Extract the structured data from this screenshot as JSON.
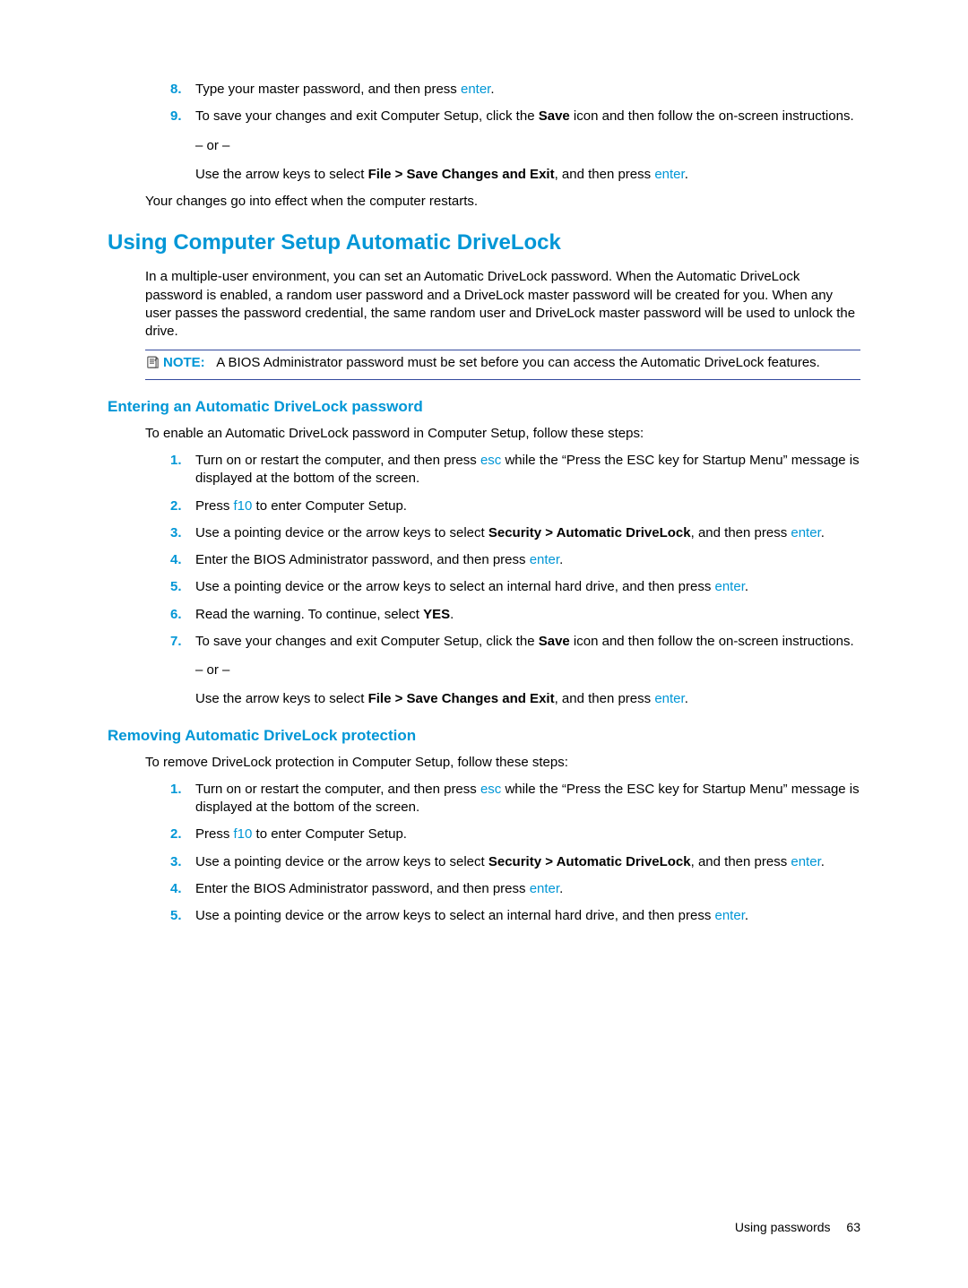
{
  "topList": {
    "item8": {
      "num": "8.",
      "text_a": "Type your master password, and then press ",
      "key": "enter",
      "text_b": "."
    },
    "item9": {
      "num": "9.",
      "text_a": "To save your changes and exit Computer Setup, click the ",
      "bold1": "Save",
      "text_b": " icon and then follow the on-screen instructions.",
      "or": "– or –",
      "text_c": "Use the arrow keys to select ",
      "bold2": "File > Save Changes and Exit",
      "text_d": ", and then press ",
      "key": "enter",
      "text_e": "."
    }
  },
  "restart_line": "Your changes go into effect when the computer restarts.",
  "h2": "Using Computer Setup Automatic DriveLock",
  "para1": "In a multiple-user environment, you can set an Automatic DriveLock password. When the Automatic DriveLock password is enabled, a random user password and a DriveLock master password will be created for you. When any user passes the password credential, the same random user and DriveLock master password will be used to unlock the drive.",
  "note": {
    "label": "NOTE:",
    "text": "A BIOS Administrator password must be set before you can access the Automatic DriveLock features."
  },
  "h3a": "Entering an Automatic DriveLock password",
  "enter_intro": "To enable an Automatic DriveLock password in Computer Setup, follow these steps:",
  "enterList": {
    "i1": {
      "num": "1.",
      "a": "Turn on or restart the computer, and then press ",
      "k1": "esc",
      "b": " while the “Press the ESC key for Startup Menu” message is displayed at the bottom of the screen."
    },
    "i2": {
      "num": "2.",
      "a": "Press ",
      "k1": "f10",
      "b": " to enter Computer Setup."
    },
    "i3": {
      "num": "3.",
      "a": "Use a pointing device or the arrow keys to select ",
      "bold": "Security > Automatic DriveLock",
      "b": ", and then press ",
      "k1": "enter",
      "c": "."
    },
    "i4": {
      "num": "4.",
      "a": "Enter the BIOS Administrator password, and then press ",
      "k1": "enter",
      "b": "."
    },
    "i5": {
      "num": "5.",
      "a": "Use a pointing device or the arrow keys to select an internal hard drive, and then press ",
      "k1": "enter",
      "b": "."
    },
    "i6": {
      "num": "6.",
      "a": "Read the warning. To continue, select ",
      "bold": "YES",
      "b": "."
    },
    "i7": {
      "num": "7.",
      "a": "To save your changes and exit Computer Setup, click the ",
      "bold1": "Save",
      "b": " icon and then follow the on-screen instructions.",
      "or": "– or –",
      "c": "Use the arrow keys to select ",
      "bold2": "File > Save Changes and Exit",
      "d": ", and then press ",
      "k1": "enter",
      "e": "."
    }
  },
  "h3b": "Removing Automatic DriveLock protection",
  "remove_intro": "To remove DriveLock protection in Computer Setup, follow these steps:",
  "removeList": {
    "i1": {
      "num": "1.",
      "a": "Turn on or restart the computer, and then press ",
      "k1": "esc",
      "b": " while the “Press the ESC key for Startup Menu” message is displayed at the bottom of the screen."
    },
    "i2": {
      "num": "2.",
      "a": "Press ",
      "k1": "f10",
      "b": " to enter Computer Setup."
    },
    "i3": {
      "num": "3.",
      "a": "Use a pointing device or the arrow keys to select ",
      "bold": "Security > Automatic DriveLock",
      "b": ", and then press ",
      "k1": "enter",
      "c": "."
    },
    "i4": {
      "num": "4.",
      "a": "Enter the BIOS Administrator password, and then press ",
      "k1": "enter",
      "b": "."
    },
    "i5": {
      "num": "5.",
      "a": "Use a pointing device or the arrow keys to select an internal hard drive, and then press ",
      "k1": "enter",
      "b": "."
    }
  },
  "footer": {
    "section": "Using passwords",
    "page": "63"
  }
}
